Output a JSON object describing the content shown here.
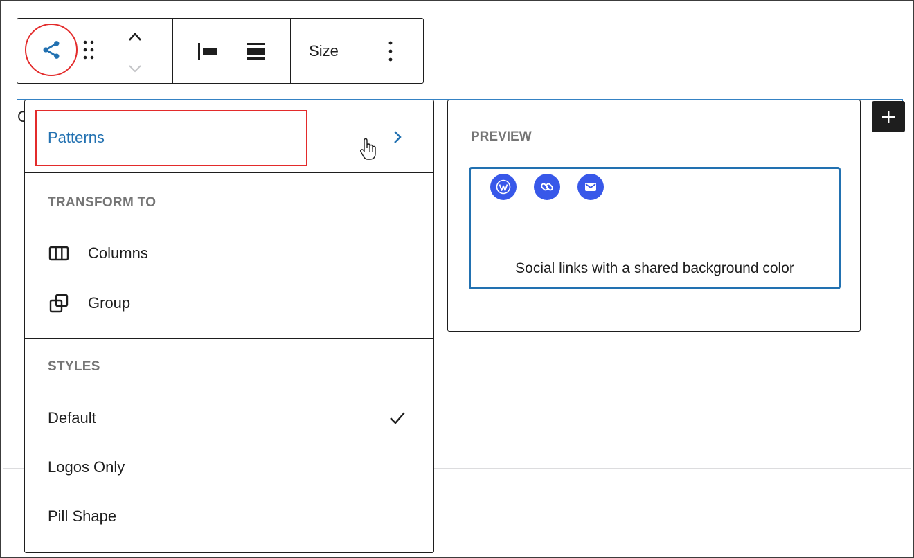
{
  "toolbar": {
    "block_icon": "share-icon",
    "drag_icon": "drag-handle-icon",
    "move_up_icon": "chevron-up-icon",
    "move_down_icon": "chevron-down-icon",
    "justify_left_icon": "justify-left-icon",
    "justify_center_icon": "justify-center-icon",
    "size_label": "Size",
    "options_icon": "more-vertical-icon"
  },
  "paragraph": {
    "partial_text": "C"
  },
  "inserter": {
    "icon": "plus-icon"
  },
  "menu": {
    "patterns_label": "Patterns",
    "patterns_icon": "chevron-right-icon",
    "transform_heading": "TRANSFORM TO",
    "transform_items": [
      {
        "label": "Columns",
        "icon": "columns-icon"
      },
      {
        "label": "Group",
        "icon": "group-icon"
      }
    ],
    "styles_heading": "STYLES",
    "style_items": [
      {
        "label": "Default",
        "selected": true
      },
      {
        "label": "Logos Only",
        "selected": false
      },
      {
        "label": "Pill Shape",
        "selected": false
      }
    ]
  },
  "preview": {
    "heading": "PREVIEW",
    "icons": [
      "wordpress-icon",
      "link-icon",
      "mail-icon"
    ],
    "caption": "Social links with a shared background color"
  },
  "colors": {
    "accent": "#2271b1",
    "highlight": "#e32b2b",
    "social_icon_bg": "#3858e9",
    "text": "#1e1e1e",
    "muted": "#757575"
  }
}
